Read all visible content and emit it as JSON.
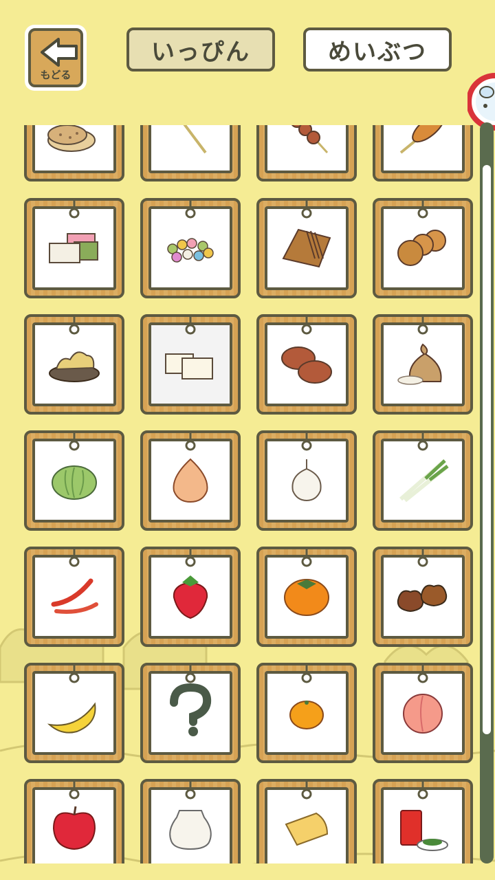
{
  "header": {
    "back_label": "もどる",
    "tabs": [
      {
        "label": "いっぴん",
        "selected": true
      },
      {
        "label": "めいぶつ",
        "selected": false
      }
    ]
  },
  "colors": {
    "background": "#f5ec94",
    "frame_wood": "#d6a254",
    "outline": "#5d5a41",
    "tab_selected_bg": "#e7dfb2"
  },
  "grid": {
    "columns": 4,
    "items": [
      {
        "name": "senbei",
        "icon": "rice-cracker-icon",
        "row": 0,
        "col": 0
      },
      {
        "name": "stick",
        "icon": "skewer-stick-icon",
        "row": 0,
        "col": 1
      },
      {
        "name": "dango",
        "icon": "dango-icon",
        "row": 0,
        "col": 2
      },
      {
        "name": "corndog",
        "icon": "corn-dog-icon",
        "row": 0,
        "col": 3
      },
      {
        "name": "mochi",
        "icon": "layered-mochi-icon",
        "row": 1,
        "col": 0
      },
      {
        "name": "candy",
        "icon": "colored-candy-icon",
        "row": 1,
        "col": 1
      },
      {
        "name": "soba",
        "icon": "soba-package-icon",
        "row": 1,
        "col": 2
      },
      {
        "name": "dorayaki",
        "icon": "dorayaki-icon",
        "row": 1,
        "col": 3
      },
      {
        "name": "tempura",
        "icon": "tempura-plate-icon",
        "row": 2,
        "col": 0
      },
      {
        "name": "tofu",
        "icon": "tofu-icon",
        "row": 2,
        "col": 1,
        "dim": true
      },
      {
        "name": "manju",
        "icon": "bun-icon",
        "row": 2,
        "col": 2
      },
      {
        "name": "rice",
        "icon": "rice-sack-icon",
        "row": 2,
        "col": 3
      },
      {
        "name": "cabbage",
        "icon": "cabbage-icon",
        "row": 3,
        "col": 0
      },
      {
        "name": "onion",
        "icon": "onion-icon",
        "row": 3,
        "col": 1
      },
      {
        "name": "garlic",
        "icon": "garlic-icon",
        "row": 3,
        "col": 2
      },
      {
        "name": "leek",
        "icon": "leek-icon",
        "row": 3,
        "col": 3
      },
      {
        "name": "pepper",
        "icon": "chili-pepper-icon",
        "row": 4,
        "col": 0
      },
      {
        "name": "strawberry",
        "icon": "strawberry-icon",
        "row": 4,
        "col": 1
      },
      {
        "name": "persimmon",
        "icon": "persimmon-icon",
        "row": 4,
        "col": 2
      },
      {
        "name": "chestnut",
        "icon": "chestnut-icon",
        "row": 4,
        "col": 3
      },
      {
        "name": "banana",
        "icon": "banana-icon",
        "row": 5,
        "col": 0
      },
      {
        "name": "unknown",
        "icon": "question-mark-icon",
        "row": 5,
        "col": 1
      },
      {
        "name": "mandarin",
        "icon": "mandarin-icon",
        "row": 5,
        "col": 2
      },
      {
        "name": "peach",
        "icon": "peach-icon",
        "row": 5,
        "col": 3
      },
      {
        "name": "apple",
        "icon": "apple-icon",
        "row": 6,
        "col": 0
      },
      {
        "name": "milk",
        "icon": "milk-jug-icon",
        "row": 6,
        "col": 1
      },
      {
        "name": "cheese",
        "icon": "cheese-icon",
        "row": 6,
        "col": 2
      },
      {
        "name": "tea",
        "icon": "tea-can-icon",
        "row": 6,
        "col": 3
      }
    ]
  },
  "scroll": {
    "position": 0.06,
    "visible_fraction": 0.8
  }
}
